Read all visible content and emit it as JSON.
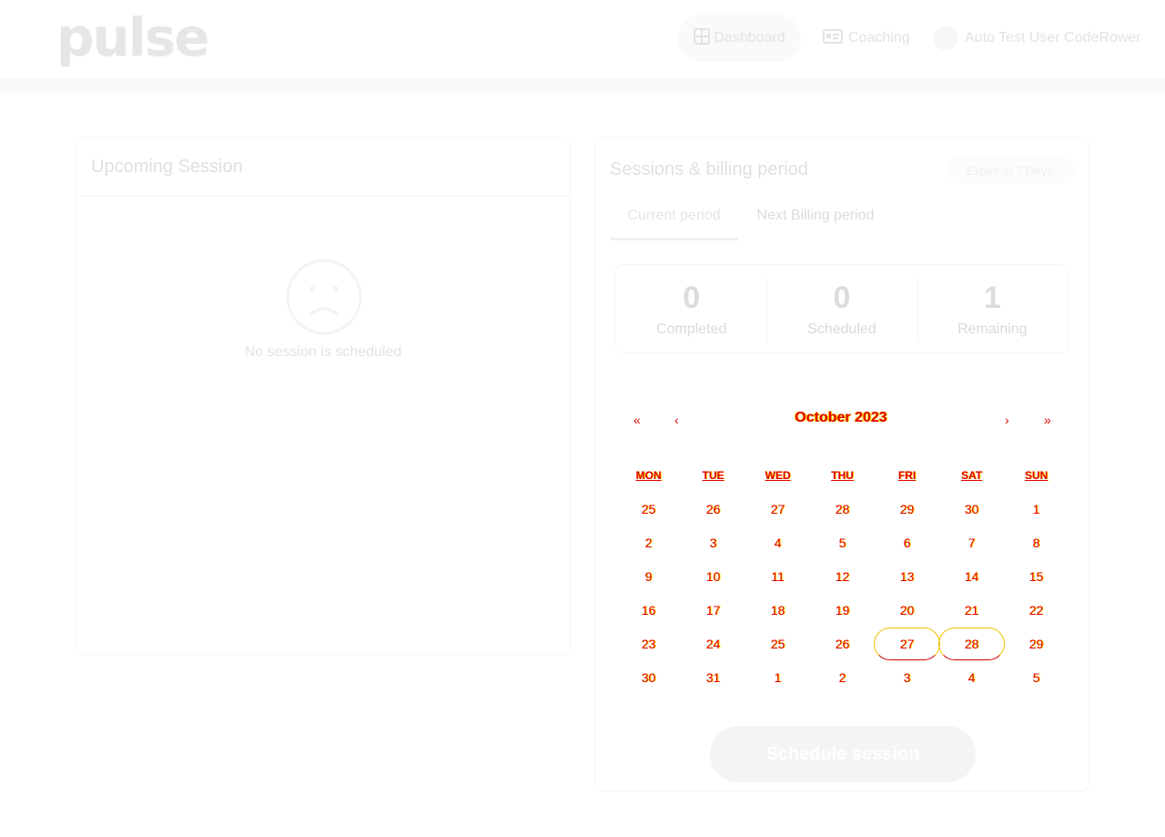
{
  "header": {
    "logo": "pulse",
    "nav": {
      "dashboard": "Dashboard",
      "coaching": "Coaching"
    },
    "user_name": "Auto Test User CodeRower"
  },
  "upcoming": {
    "title": "Upcoming Session",
    "empty_text": "No session is scheduled"
  },
  "billing": {
    "title": "Sessions & billing period",
    "expire_badge": "Expire in 7 Days!",
    "tabs": {
      "current": "Current period",
      "next": "Next Billing period"
    },
    "stats": {
      "completed": {
        "value": "0",
        "label": "Completed"
      },
      "scheduled": {
        "value": "0",
        "label": "Scheduled"
      },
      "remaining": {
        "value": "1",
        "label": "Remaining"
      }
    }
  },
  "calendar": {
    "month_label": "October 2023",
    "nav": {
      "prev_year": "«",
      "prev_month": "‹",
      "next_month": "›",
      "next_year": "»"
    },
    "weekdays": [
      "MON",
      "TUE",
      "WED",
      "THU",
      "FRI",
      "SAT",
      "SUN"
    ],
    "weeks": [
      [
        "25",
        "26",
        "27",
        "28",
        "29",
        "30",
        "1"
      ],
      [
        "2",
        "3",
        "4",
        "5",
        "6",
        "7",
        "8"
      ],
      [
        "9",
        "10",
        "11",
        "12",
        "13",
        "14",
        "15"
      ],
      [
        "16",
        "17",
        "18",
        "19",
        "20",
        "21",
        "22"
      ],
      [
        "23",
        "24",
        "25",
        "26",
        "27",
        "28",
        "29"
      ],
      [
        "30",
        "31",
        "1",
        "2",
        "3",
        "4",
        "5"
      ]
    ],
    "highlighted": [
      "27",
      "28"
    ]
  },
  "actions": {
    "schedule": "Schedule session"
  }
}
